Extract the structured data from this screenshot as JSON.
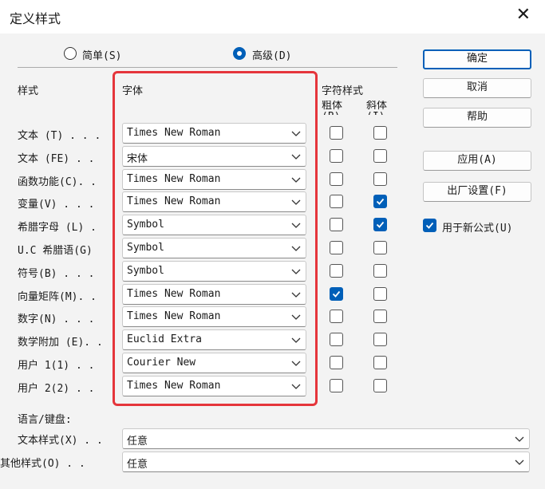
{
  "window": {
    "title": "定义样式"
  },
  "mode": {
    "simple_label": "简单(S)",
    "advanced_label": "高级(D)",
    "selected": "advanced"
  },
  "headers": {
    "style": "样式",
    "font": "字体",
    "char_style": "字符样式",
    "bold": "粗体(B)",
    "italic": "斜体(I)"
  },
  "rows": [
    {
      "label": "文本 (T) . . .",
      "font": "Times New Roman",
      "bold": false,
      "italic": false
    },
    {
      "label": "文本 (FE) . .",
      "font": "宋体",
      "bold": false,
      "italic": false
    },
    {
      "label": "函数功能(C). .",
      "font": "Times New Roman",
      "bold": false,
      "italic": false
    },
    {
      "label": "变量(V) . . .",
      "font": "Times New Roman",
      "bold": false,
      "italic": true
    },
    {
      "label": "希腊字母 (L) .",
      "font": "Symbol",
      "bold": false,
      "italic": true
    },
    {
      "label": "U.C 希腊语(G)",
      "font": "Symbol",
      "bold": false,
      "italic": false
    },
    {
      "label": "符号(B) . . .",
      "font": "Symbol",
      "bold": false,
      "italic": false
    },
    {
      "label": "向量矩阵(M). .",
      "font": "Times New Roman",
      "bold": true,
      "italic": false
    },
    {
      "label": "数字(N) . . .",
      "font": "Times New Roman",
      "bold": false,
      "italic": false
    },
    {
      "label": "数学附加 (E). .",
      "font": "Euclid Extra",
      "bold": false,
      "italic": false
    },
    {
      "label": "用户 1(1) . .",
      "font": "Courier New",
      "bold": false,
      "italic": false
    },
    {
      "label": "用户 2(2) . .",
      "font": "Times New Roman",
      "bold": false,
      "italic": false
    }
  ],
  "buttons": {
    "ok": "确定",
    "cancel": "取消",
    "help": "帮助",
    "apply": "应用(A)",
    "factory": "出厂设置(F)"
  },
  "use_new_formula": {
    "label": "用于新公式(U)",
    "checked": true
  },
  "language": {
    "heading": "语言/键盘:",
    "text_style_label": "文本样式(X) . .",
    "text_style_value": "任意",
    "other_style_label": "其他样式(O) . .",
    "other_style_value": "任意"
  },
  "colors": {
    "accent": "#005fb8",
    "highlight": "#e5353b"
  }
}
